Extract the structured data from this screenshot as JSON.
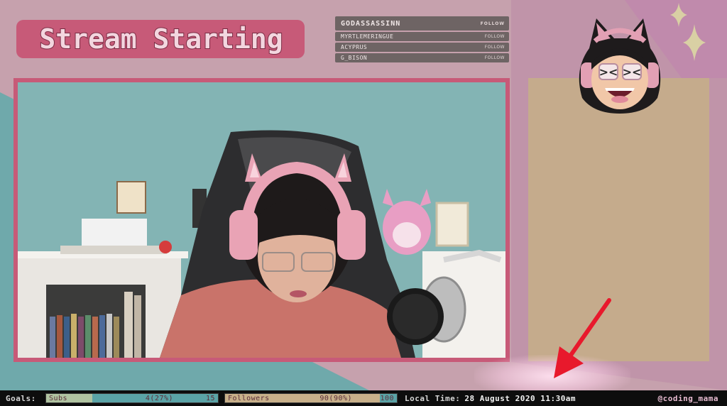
{
  "overlay": {
    "title": "Stream Starting",
    "colors": {
      "background": "#c6a1ad",
      "cam_border": "#c75a78",
      "chat_panel": "#c5ab8c",
      "teal_accent": "#5aa3a6",
      "title_fill": "#f3d6df",
      "arrow": "#e8192c"
    }
  },
  "recent_followers": [
    {
      "name": "GODASSASSINN",
      "action": "FOLLOW"
    },
    {
      "name": "MYRTLEMERINGUE",
      "action": "FOLLOW"
    },
    {
      "name": "ACYPRUS",
      "action": "FOLLOW"
    },
    {
      "name": "G_BISON",
      "action": "FOLLOW"
    }
  ],
  "webcam": {
    "scene": "streamer-with-cat-ear-headphones"
  },
  "avatar": {
    "icon": "cat-ear-girl-avatar-icon"
  },
  "footer": {
    "goals_label": "Goals:",
    "subs": {
      "label": "Subs",
      "text": "4(27%)",
      "max": "15",
      "fraction": 0.27,
      "fill_color": "#b0c3a1"
    },
    "followers": {
      "label": "Followers",
      "text": "90(90%)",
      "max": "100",
      "fraction": 0.9,
      "fill_color": "#c8b08a"
    },
    "local_time_label": "Local Time:",
    "local_time_value": "28 August 2020 11:30am",
    "handle": "@coding_mama"
  },
  "annotation": {
    "icon": "red-arrow-icon"
  }
}
